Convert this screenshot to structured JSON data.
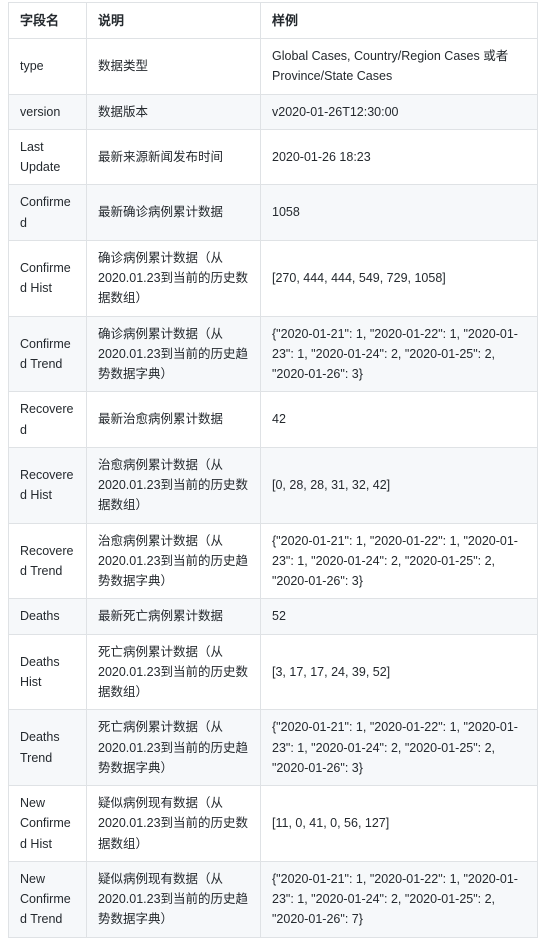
{
  "table": {
    "name": "api-field-reference-table",
    "columns": [
      "字段名",
      "说明",
      "样例"
    ],
    "rows": [
      {
        "field": "type",
        "description": "数据类型",
        "sample": "Global Cases, Country/Region Cases 或者 Province/State Cases"
      },
      {
        "field": "version",
        "description": "数据版本",
        "sample": "v2020-01-26T12:30:00"
      },
      {
        "field": "Last Update",
        "description": "最新来源新闻发布时间",
        "sample": "2020-01-26 18:23"
      },
      {
        "field": "Confirmed",
        "description": "最新确诊病例累计数据",
        "sample": "1058"
      },
      {
        "field": "Confirmed Hist",
        "description": "确诊病例累计数据（从2020.01.23到当前的历史数据数组）",
        "sample": "[270, 444, 444, 549, 729, 1058]"
      },
      {
        "field": "Confirmed Trend",
        "description": "确诊病例累计数据（从2020.01.23到当前的历史趋势数据字典）",
        "sample": "{\"2020-01-21\": 1, \"2020-01-22\": 1, \"2020-01-23\": 1, \"2020-01-24\": 2, \"2020-01-25\": 2, \"2020-01-26\": 3}"
      },
      {
        "field": "Recovered",
        "description": "最新治愈病例累计数据",
        "sample": "42"
      },
      {
        "field": "Recovered Hist",
        "description": "治愈病例累计数据（从2020.01.23到当前的历史数据数组）",
        "sample": "[0, 28, 28, 31, 32, 42]"
      },
      {
        "field": "Recovered Trend",
        "description": "治愈病例累计数据（从2020.01.23到当前的历史趋势数据字典）",
        "sample": "{\"2020-01-21\": 1, \"2020-01-22\": 1, \"2020-01-23\": 1, \"2020-01-24\": 2, \"2020-01-25\": 2, \"2020-01-26\": 3}"
      },
      {
        "field": "Deaths",
        "description": "最新死亡病例累计数据",
        "sample": "52"
      },
      {
        "field": "Deaths Hist",
        "description": "死亡病例累计数据（从2020.01.23到当前的历史数据数组）",
        "sample": "[3, 17, 17, 24, 39, 52]"
      },
      {
        "field": "Deaths Trend",
        "description": "死亡病例累计数据（从2020.01.23到当前的历史趋势数据字典）",
        "sample": "{\"2020-01-21\": 1, \"2020-01-22\": 1, \"2020-01-23\": 1, \"2020-01-24\": 2, \"2020-01-25\": 2, \"2020-01-26\": 3}"
      },
      {
        "field": "New Confirmed Hist",
        "description": "疑似病例现有数据（从2020.01.23到当前的历史数据数组）",
        "sample": "[11, 0, 41, 0, 56, 127]"
      },
      {
        "field": "New Confirmed Trend",
        "description": "疑似病例现有数据（从2020.01.23到当前的历史趋势数据字典）",
        "sample": "{\"2020-01-21\": 1, \"2020-01-22\": 1, \"2020-01-23\": 1, \"2020-01-24\": 2, \"2020-01-25\": 2, \"2020-01-26\": 7}"
      }
    ]
  },
  "colors": {
    "border": "#dfe2e5",
    "stripe": "#f6f8fa",
    "text": "#24292e",
    "background": "#ffffff"
  }
}
